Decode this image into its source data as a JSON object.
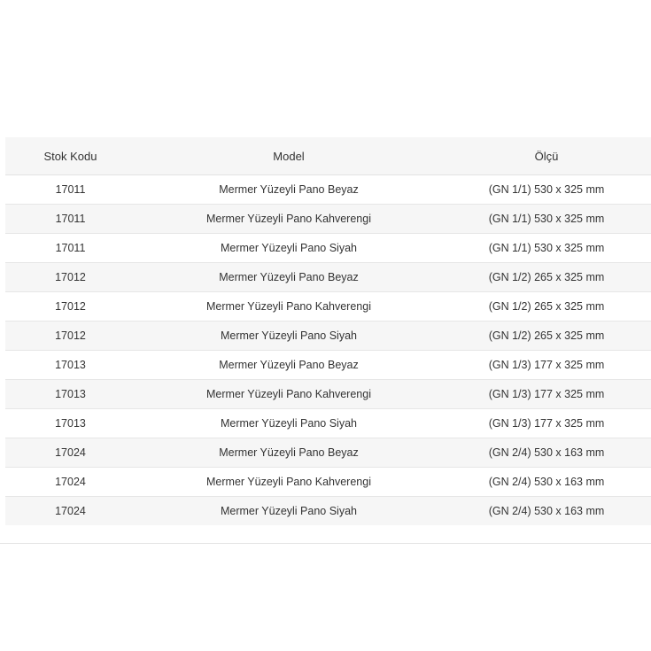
{
  "table": {
    "headers": {
      "stock_code": "Stok Kodu",
      "model": "Model",
      "size": "Ölçü"
    },
    "rows": [
      {
        "stock_code": "17011",
        "model": "Mermer Yüzeyli Pano Beyaz",
        "size": "(GN 1/1) 530 x 325 mm"
      },
      {
        "stock_code": "17011",
        "model": "Mermer Yüzeyli Pano Kahverengi",
        "size": "(GN 1/1) 530 x 325 mm"
      },
      {
        "stock_code": "17011",
        "model": "Mermer Yüzeyli Pano Siyah",
        "size": "(GN 1/1) 530 x 325 mm"
      },
      {
        "stock_code": "17012",
        "model": "Mermer Yüzeyli Pano Beyaz",
        "size": "(GN 1/2) 265 x 325 mm"
      },
      {
        "stock_code": "17012",
        "model": "Mermer Yüzeyli Pano Kahverengi",
        "size": "(GN 1/2) 265 x 325 mm"
      },
      {
        "stock_code": "17012",
        "model": "Mermer Yüzeyli Pano Siyah",
        "size": "(GN 1/2) 265 x 325 mm"
      },
      {
        "stock_code": "17013",
        "model": "Mermer Yüzeyli Pano Beyaz",
        "size": "(GN 1/3) 177 x 325 mm"
      },
      {
        "stock_code": "17013",
        "model": "Mermer Yüzeyli Pano Kahverengi",
        "size": "(GN 1/3) 177 x 325 mm"
      },
      {
        "stock_code": "17013",
        "model": "Mermer Yüzeyli Pano Siyah",
        "size": "(GN 1/3) 177 x 325 mm"
      },
      {
        "stock_code": "17024",
        "model": "Mermer Yüzeyli Pano Beyaz",
        "size": "(GN 2/4) 530 x 163 mm"
      },
      {
        "stock_code": "17024",
        "model": "Mermer Yüzeyli Pano Kahverengi",
        "size": "(GN 2/4) 530 x 163 mm"
      },
      {
        "stock_code": "17024",
        "model": "Mermer Yüzeyli Pano Siyah",
        "size": "(GN 2/4) 530 x 163 mm"
      }
    ]
  }
}
